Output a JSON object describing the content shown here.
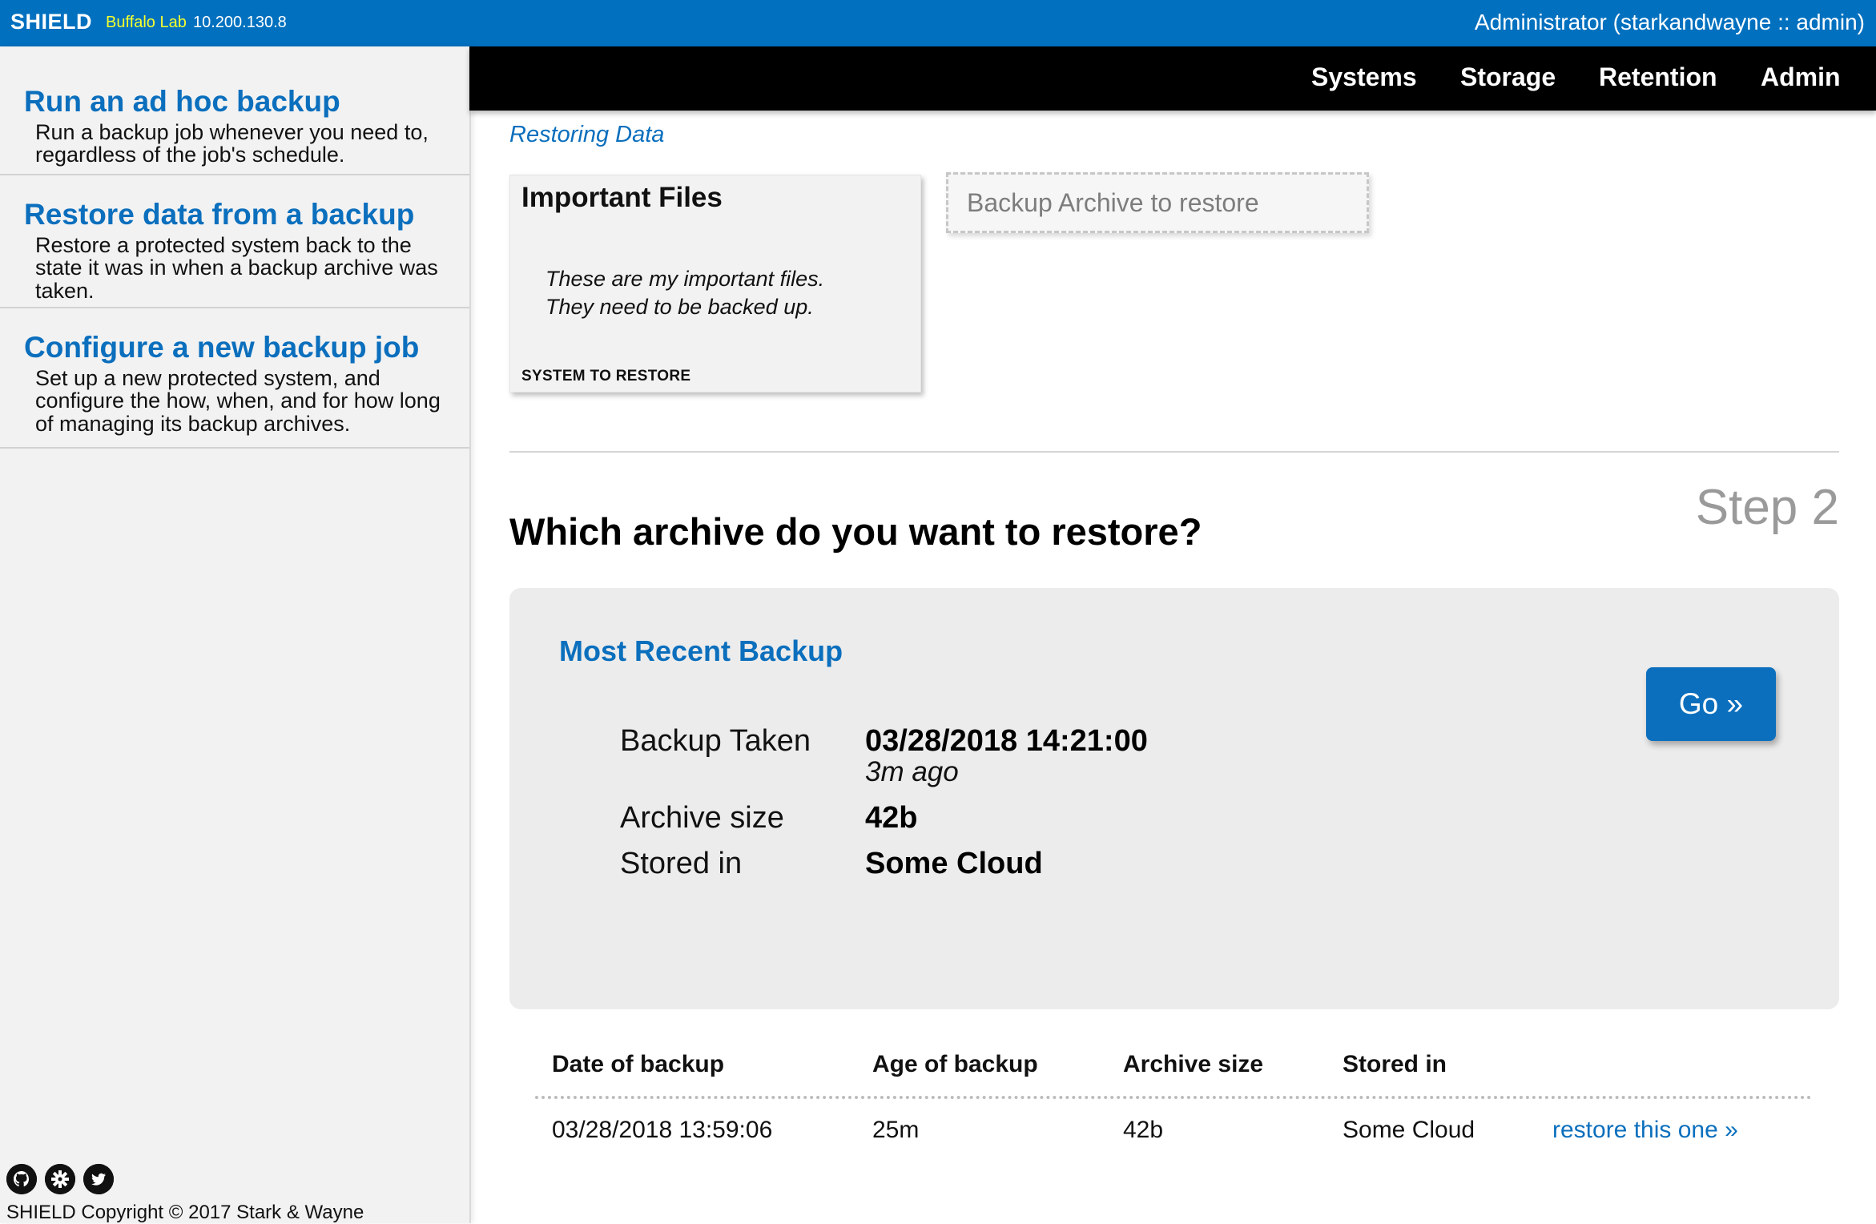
{
  "topbar": {
    "brand": "SHIELD",
    "environment": "Buffalo Lab",
    "ip": "10.200.130.8",
    "user": "Administrator (starkandwayne :: admin)"
  },
  "nav": {
    "items": [
      {
        "label": "Systems"
      },
      {
        "label": "Storage"
      },
      {
        "label": "Retention"
      },
      {
        "label": "Admin"
      }
    ]
  },
  "sidebar": {
    "items": [
      {
        "title": "Run an ad hoc backup",
        "description": "Run a backup job whenever you need to, regardless of the job's schedule."
      },
      {
        "title": "Restore data from a backup",
        "description": "Restore a protected system back to the state it was in when a backup archive was taken."
      },
      {
        "title": "Configure a new backup job",
        "description": "Set up a new protected system, and configure the how, when, and for how long of managing its backup archives."
      }
    ],
    "footer": {
      "icons": [
        "github-icon",
        "settings-icon",
        "twitter-icon"
      ],
      "copyright": "SHIELD Copyright © 2017 Stark & Wayne"
    }
  },
  "main": {
    "breadcrumb": "Restoring Data",
    "system_card": {
      "title": "Important Files",
      "description_line1": "These are my important files.",
      "description_line2": "They need to be backed up.",
      "label": "SYSTEM TO RESTORE"
    },
    "archive_placeholder": "Backup Archive to restore",
    "step": "Step 2",
    "question": "Which archive do you want to restore?",
    "recent": {
      "title": "Most Recent Backup",
      "taken_label": "Backup Taken",
      "taken_value": "03/28/2018 14:21:00",
      "taken_ago": "3m ago",
      "size_label": "Archive size",
      "size_value": "42b",
      "stored_label": "Stored in",
      "stored_value": "Some Cloud",
      "go_label": "Go »"
    },
    "table": {
      "headers": [
        "Date of backup",
        "Age of backup",
        "Archive size",
        "Stored in"
      ],
      "rows": [
        {
          "date": "03/28/2018 13:59:06",
          "age": "25m",
          "size": "42b",
          "store": "Some Cloud",
          "action": "restore this one »"
        }
      ]
    }
  },
  "colors": {
    "topbar": "#0070bf",
    "accent": "#0b6fbd",
    "env_text": "#f5ff2c",
    "navbar": "#000000",
    "sidebar_bg": "#f2f2f2",
    "panel_bg": "#ececec"
  }
}
